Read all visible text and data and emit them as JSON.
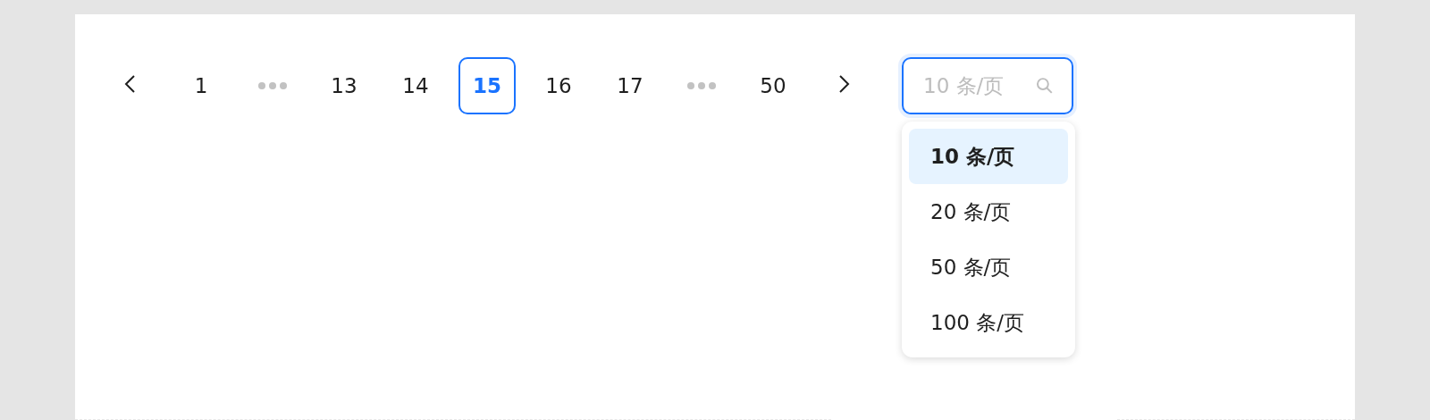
{
  "pagination": {
    "items": [
      {
        "kind": "prev"
      },
      {
        "kind": "page",
        "label": "1",
        "selected": false
      },
      {
        "kind": "ellipsis"
      },
      {
        "kind": "page",
        "label": "13",
        "selected": false
      },
      {
        "kind": "page",
        "label": "14",
        "selected": false
      },
      {
        "kind": "page",
        "label": "15",
        "selected": true
      },
      {
        "kind": "page",
        "label": "16",
        "selected": false
      },
      {
        "kind": "page",
        "label": "17",
        "selected": false
      },
      {
        "kind": "ellipsis"
      },
      {
        "kind": "page",
        "label": "50",
        "selected": false
      },
      {
        "kind": "next"
      }
    ]
  },
  "page_size_select": {
    "placeholder": "10 条/页",
    "expanded": true,
    "options": [
      {
        "label": "10 条/页",
        "selected": true
      },
      {
        "label": "20 条/页",
        "selected": false
      },
      {
        "label": "50 条/页",
        "selected": false
      },
      {
        "label": "100 条/页",
        "selected": false
      }
    ]
  }
}
